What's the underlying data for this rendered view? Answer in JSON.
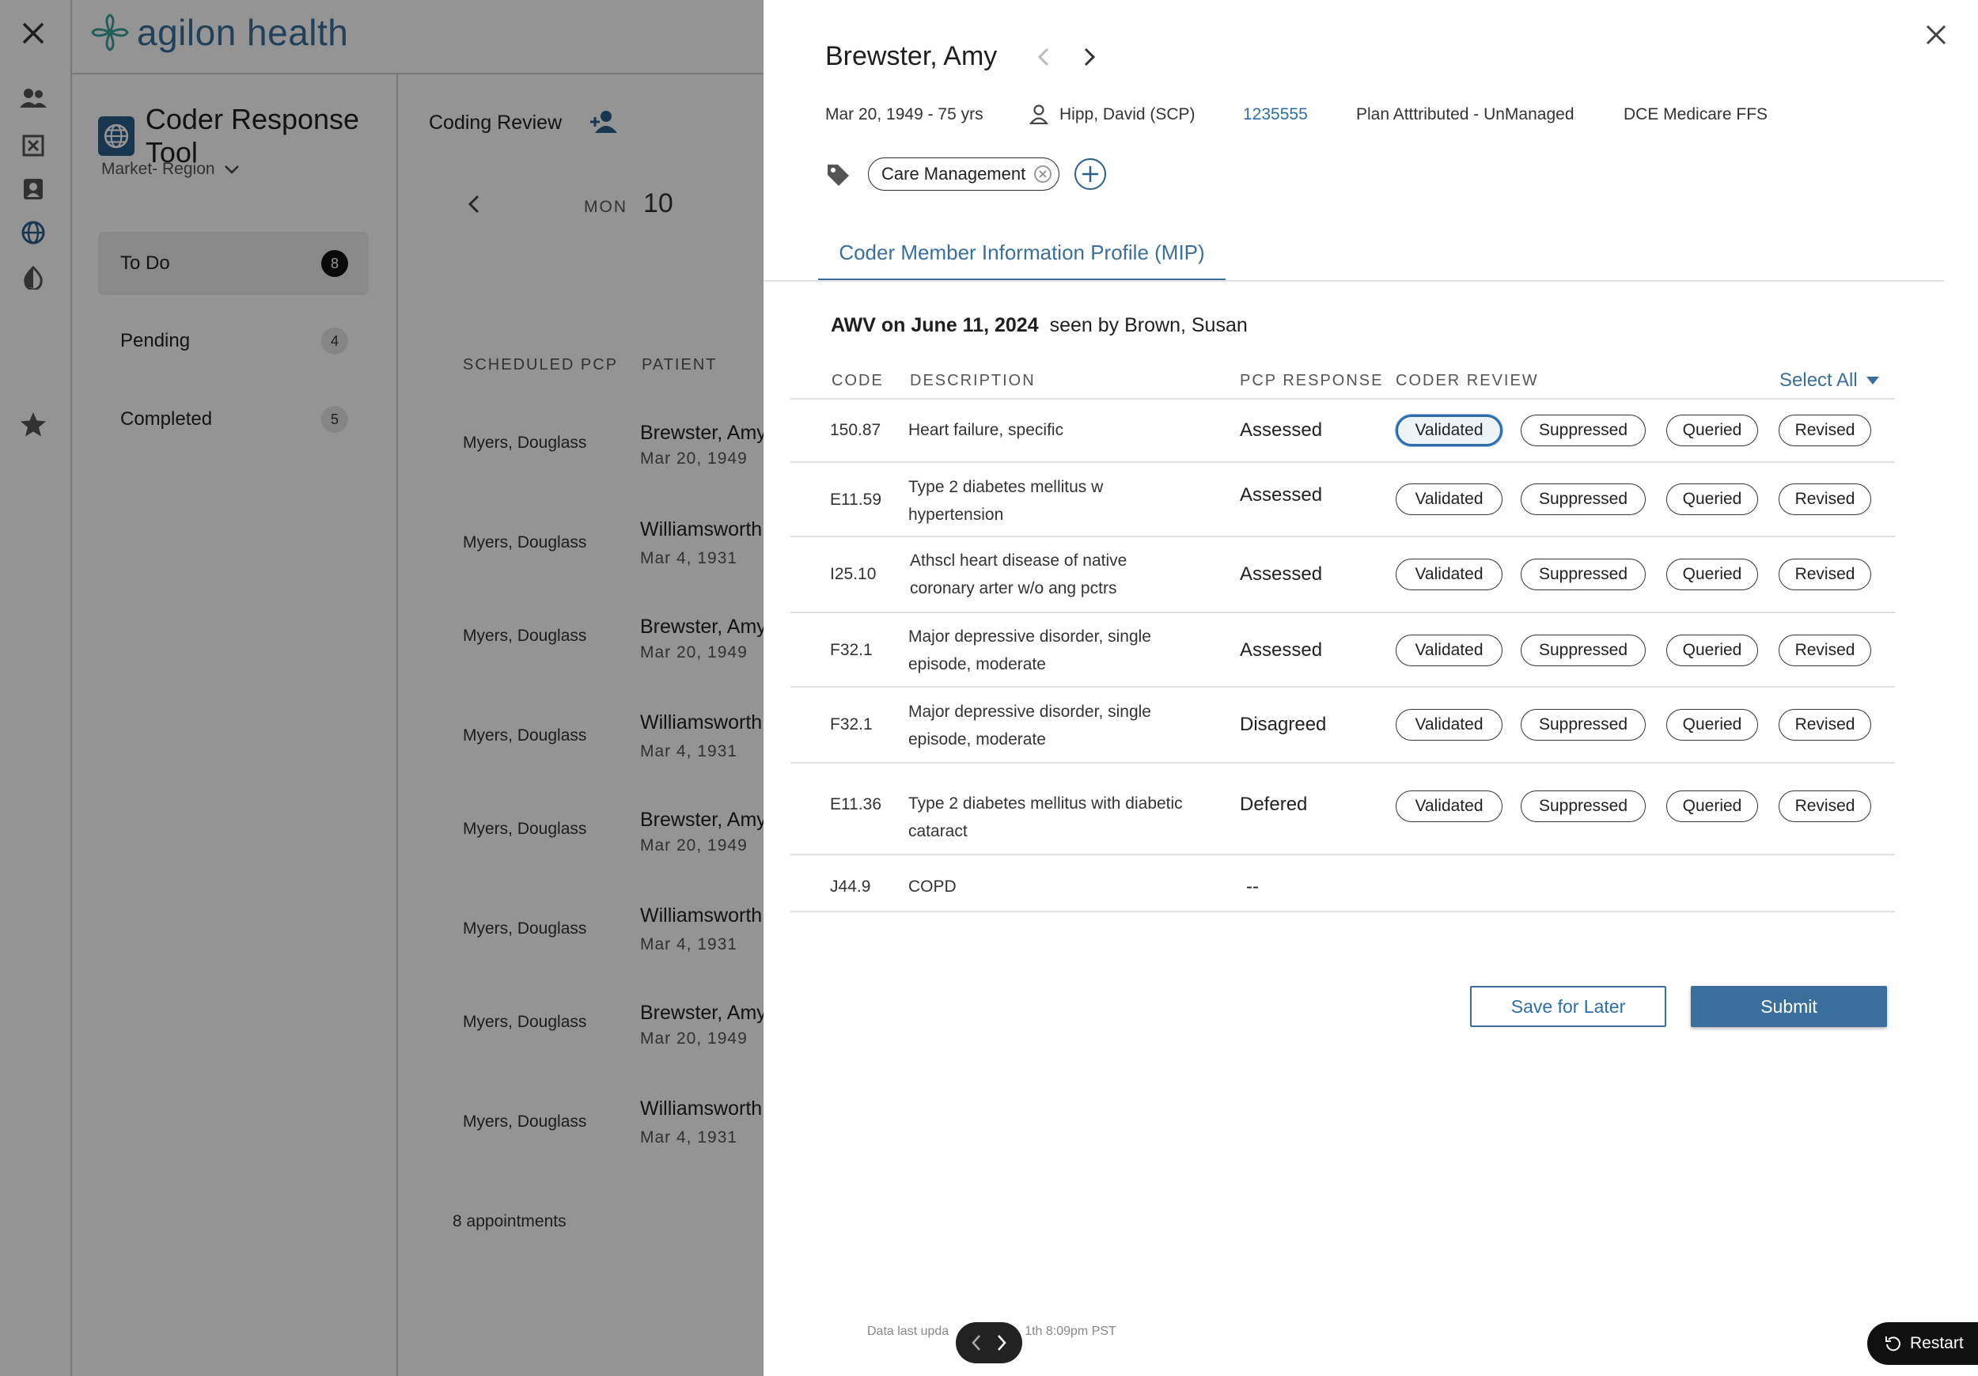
{
  "app": {
    "brand": "agilon health",
    "tool_title": "Coder Response Tool",
    "market_label": "Market- Region",
    "coding_review": "Coding Review",
    "nav": [
      {
        "label": "To Do",
        "count": "8"
      },
      {
        "label": "Pending",
        "count": "4"
      },
      {
        "label": "Completed",
        "count": "5"
      }
    ],
    "calendar": {
      "dow": "MON",
      "day": "10"
    },
    "columns": {
      "pcp": "SCHEDULED PCP",
      "patient": "PATIENT"
    },
    "appointments": [
      {
        "pcp": "Myers, Douglass",
        "patient": "Brewster, Amy",
        "dob": "Mar 20, 1949"
      },
      {
        "pcp": "Myers, Douglass",
        "patient": "Williamsworth",
        "dob": "Mar 4, 1931"
      },
      {
        "pcp": "Myers, Douglass",
        "patient": "Brewster, Amy",
        "dob": "Mar 20, 1949"
      },
      {
        "pcp": "Myers, Douglass",
        "patient": "Williamsworth",
        "dob": "Mar 4, 1931"
      },
      {
        "pcp": "Myers, Douglass",
        "patient": "Brewster, Amy",
        "dob": "Mar 20, 1949"
      },
      {
        "pcp": "Myers, Douglass",
        "patient": "Williamsworth",
        "dob": "Mar 4, 1931"
      },
      {
        "pcp": "Myers, Douglass",
        "patient": "Brewster, Amy",
        "dob": "Mar 20, 1949"
      },
      {
        "pcp": "Myers, Douglass",
        "patient": "Williamsworth",
        "dob": "Mar 4, 1931"
      }
    ],
    "appointments_count": "8 appointments"
  },
  "drawer": {
    "patient_name": "Brewster, Amy",
    "dob_age": "Mar 20, 1949 - 75 yrs",
    "provider": "Hipp, David (SCP)",
    "member_id": "1235555",
    "plan_status": "Plan Atttributed - UnManaged",
    "program": "DCE Medicare FFS",
    "tag": "Care Management",
    "tab_label": "Coder Member Information Profile (MIP)",
    "visit": {
      "title": "AWV on June 11, 2024",
      "seen_by": "seen by Brown, Susan"
    },
    "table_headers": {
      "code": "CODE",
      "description": "DESCRIPTION",
      "pcp_response": "PCP RESPONSE",
      "coder_review": "CODER REVIEW"
    },
    "select_all": "Select All",
    "review_options": [
      "Validated",
      "Suppressed",
      "Queried",
      "Revised"
    ],
    "rows": [
      {
        "code": "150.87",
        "desc1": "Heart failure, specific",
        "desc2": "",
        "response": "Assessed",
        "selected": "Validated"
      },
      {
        "code": "E11.59",
        "desc1": "Type 2 diabetes mellitus w",
        "desc2": "hypertension",
        "response": "Assessed",
        "selected": ""
      },
      {
        "code": "I25.10",
        "desc1": "Athscl heart disease of native",
        "desc2": "coronary arter w/o ang pctrs",
        "response": "Assessed",
        "selected": ""
      },
      {
        "code": "F32.1",
        "desc1": "Major depressive disorder, single",
        "desc2": "episode, moderate",
        "response": "Assessed",
        "selected": ""
      },
      {
        "code": "F32.1",
        "desc1": "Major depressive disorder, single",
        "desc2": "episode, moderate",
        "response": "Disagreed",
        "selected": ""
      },
      {
        "code": "E11.36",
        "desc1": "Type 2 diabetes mellitus with diabetic",
        "desc2": "cataract",
        "response": "Defered",
        "selected": ""
      },
      {
        "code": "J44.9",
        "desc1": "COPD",
        "desc2": "",
        "response": "--",
        "selected": ""
      }
    ],
    "save_for_later": "Save for Later",
    "submit": "Submit",
    "footnote_left": "Data last upda",
    "footnote_right": "1th 8:09pm PST",
    "restart": "Restart"
  },
  "colors": {
    "accent": "#3a6f9b",
    "link": "#2c6fa8",
    "selected_border": "#2c6fa8"
  }
}
